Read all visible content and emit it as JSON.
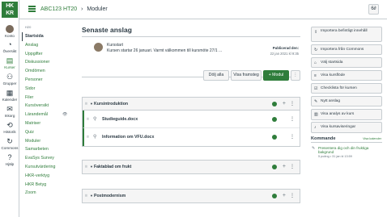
{
  "logo_text": "HK\nKR",
  "global_nav": [
    {
      "label": "Konto",
      "icon": "avatar"
    },
    {
      "label": "Översikt",
      "icon": "dashboard-icon"
    },
    {
      "label": "Kurser",
      "icon": "courses-icon",
      "active": true
    },
    {
      "label": "Grupper",
      "icon": "groups-icon"
    },
    {
      "label": "Kalender",
      "icon": "calendar-icon"
    },
    {
      "label": "Inkorg",
      "icon": "inbox-icon"
    },
    {
      "label": "Historik",
      "icon": "history-icon"
    },
    {
      "label": "Commons",
      "icon": "commons-icon"
    },
    {
      "label": "Hjälp",
      "icon": "help-icon"
    }
  ],
  "header": {
    "course_link": "ABC123 HT20",
    "separator": "›",
    "current": "Moduler",
    "tool_label": "6∂"
  },
  "course_nav": {
    "term": "H20",
    "items": [
      {
        "label": "Startsida",
        "active": true
      },
      {
        "label": "Anslag"
      },
      {
        "label": "Uppgifter"
      },
      {
        "label": "Diskussioner"
      },
      {
        "label": "Omdömen"
      },
      {
        "label": "Personer"
      },
      {
        "label": "Sidor"
      },
      {
        "label": "Filer"
      },
      {
        "label": "Kursöversikt"
      },
      {
        "label": "Lärandemål",
        "hidden": true
      },
      {
        "label": "Matriser"
      },
      {
        "label": "Quiz"
      },
      {
        "label": "Moduler"
      },
      {
        "label": "Samarbeten"
      },
      {
        "label": "EvaSys Survey"
      },
      {
        "label": "Kursutvärdering"
      },
      {
        "label": "HKR-verktyg"
      },
      {
        "label": "HKR Betyg"
      },
      {
        "label": "Zoom"
      }
    ]
  },
  "main": {
    "recent_heading": "Senaste anslag",
    "announcement": {
      "title": "Kursstart",
      "text": "Kursen startar 26 januari. Varmt välkommen till kursmöte 27/1 ...",
      "published_label": "Publicerad den:",
      "date": "22 jan 2021 kl 9:35"
    },
    "buttons": {
      "collapse": "Dölj alla",
      "progress": "Visa framsteg",
      "add_module": "+ Modul",
      "more": "⋮"
    },
    "modules": [
      {
        "title": "Kursintroduktion",
        "items": [
          "Studieguide.docx",
          "Information om VFU.docx"
        ]
      },
      {
        "title": "Faktablad om frukt",
        "items": []
      },
      {
        "title": "Postmodernism",
        "items": []
      }
    ]
  },
  "sidebar": {
    "buttons": [
      {
        "label": "Importera befintligt innehåll",
        "icon": "import-icon"
      },
      {
        "label": "Importera från Commons",
        "icon": "commons-icon"
      },
      {
        "label": "Välj startsida",
        "icon": "home-icon"
      },
      {
        "label": "Visa kursflöde",
        "icon": "stream-icon"
      },
      {
        "label": "Checklista för kursen",
        "icon": "checklist-icon"
      },
      {
        "label": "Nytt anslag",
        "icon": "announcement-icon"
      },
      {
        "label": "Visa analys av kurs",
        "icon": "analytics-icon"
      },
      {
        "label": "Visa kursaviseringar",
        "icon": "bell-icon"
      }
    ],
    "coming": {
      "heading": "Kommande",
      "calendar_link": "Visa kalender",
      "item_title": "Presentera dig och din fruktiga bakgrund",
      "item_meta": "5 poäng • 31 jan kl 13:59"
    }
  }
}
